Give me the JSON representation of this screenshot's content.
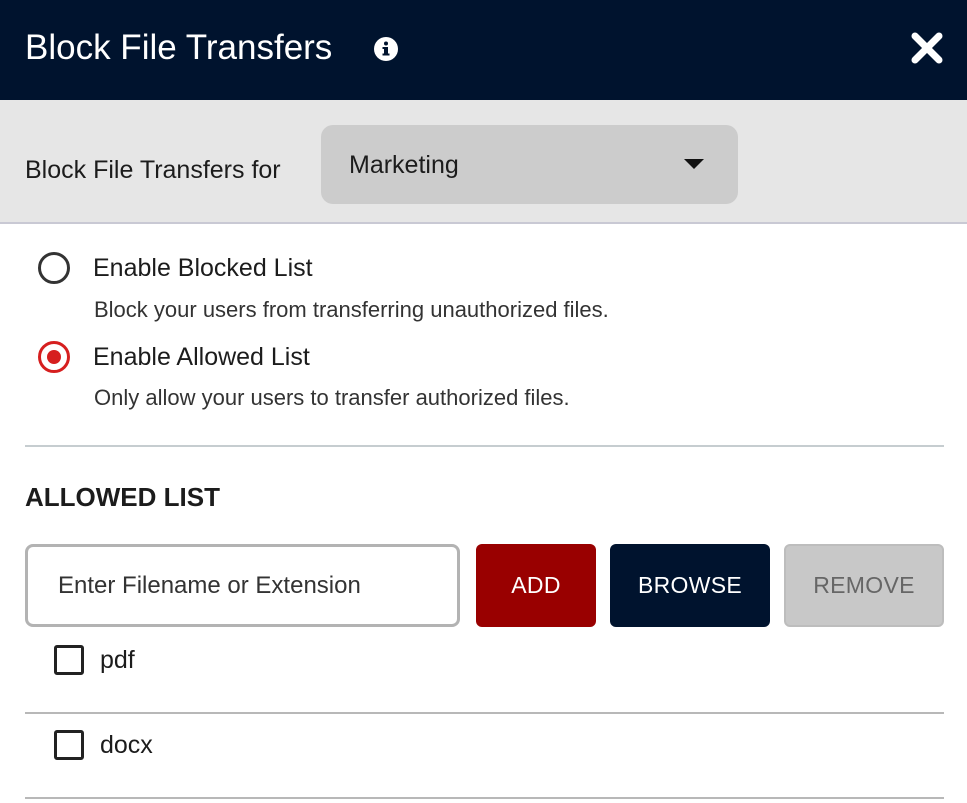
{
  "dialog": {
    "title": "Block File Transfers",
    "info_icon": "info-icon",
    "close_icon": "close-icon"
  },
  "selector": {
    "label": "Block File Transfers for",
    "selected_value": "Marketing",
    "icon": "chevron-down-icon"
  },
  "mode": {
    "options": [
      {
        "label": "Enable Blocked List",
        "description": "Block your users from transferring unauthorized files.",
        "selected": false
      },
      {
        "label": "Enable Allowed List",
        "description": "Only allow your users to transfer authorized files.",
        "selected": true
      }
    ]
  },
  "allowed_list": {
    "heading": "ALLOWED LIST",
    "input_placeholder": "Enter Filename or Extension",
    "input_value": "",
    "add_label": "ADD",
    "browse_label": "BROWSE",
    "remove_label": "REMOVE",
    "items": [
      {
        "name": "pdf",
        "checked": false
      },
      {
        "name": "docx",
        "checked": false
      }
    ]
  },
  "colors": {
    "header_bg": "#00132e",
    "accent_red": "#990000",
    "radio_selected": "#d61f1f",
    "disabled_button": "#c8c8c8"
  }
}
